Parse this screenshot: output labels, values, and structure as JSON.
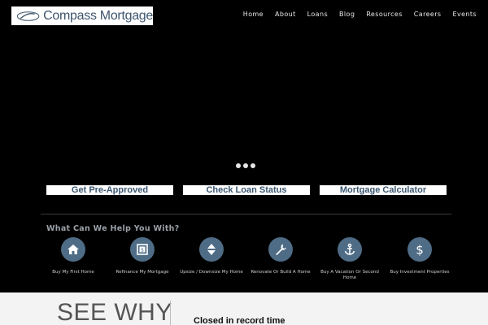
{
  "brand": {
    "name": "Compass Mortgage"
  },
  "nav": [
    {
      "label": "Home"
    },
    {
      "label": "About"
    },
    {
      "label": "Loans"
    },
    {
      "label": "Blog"
    },
    {
      "label": "Resources"
    },
    {
      "label": "Careers"
    },
    {
      "label": "Events"
    }
  ],
  "hero": {
    "slides": 3
  },
  "cta": {
    "pre_approved": "Get Pre-Approved",
    "loan_status": "Check Loan Status",
    "calculator": "Mortgage Calculator"
  },
  "help": {
    "title": "What Can We Help You With?",
    "items": [
      {
        "label": "Buy My First Home",
        "icon": "home-icon"
      },
      {
        "label": "Refinance My Mortgage",
        "icon": "money-icon"
      },
      {
        "label": "Upsize / Downsize My Home",
        "icon": "up-down-arrows-icon"
      },
      {
        "label": "Renovate Or Build A Home",
        "icon": "wrench-icon"
      },
      {
        "label": "Buy A Vacation Or Second Home",
        "icon": "anchor-icon"
      },
      {
        "label": "Buy Investment Properties",
        "icon": "dollar-icon"
      }
    ]
  },
  "bottom": {
    "heading": "SEE WHY",
    "testimonial": "Closed in record time"
  },
  "colors": {
    "accent": "#4f6c86",
    "cta_text": "#3a5670",
    "background": "#000000"
  }
}
